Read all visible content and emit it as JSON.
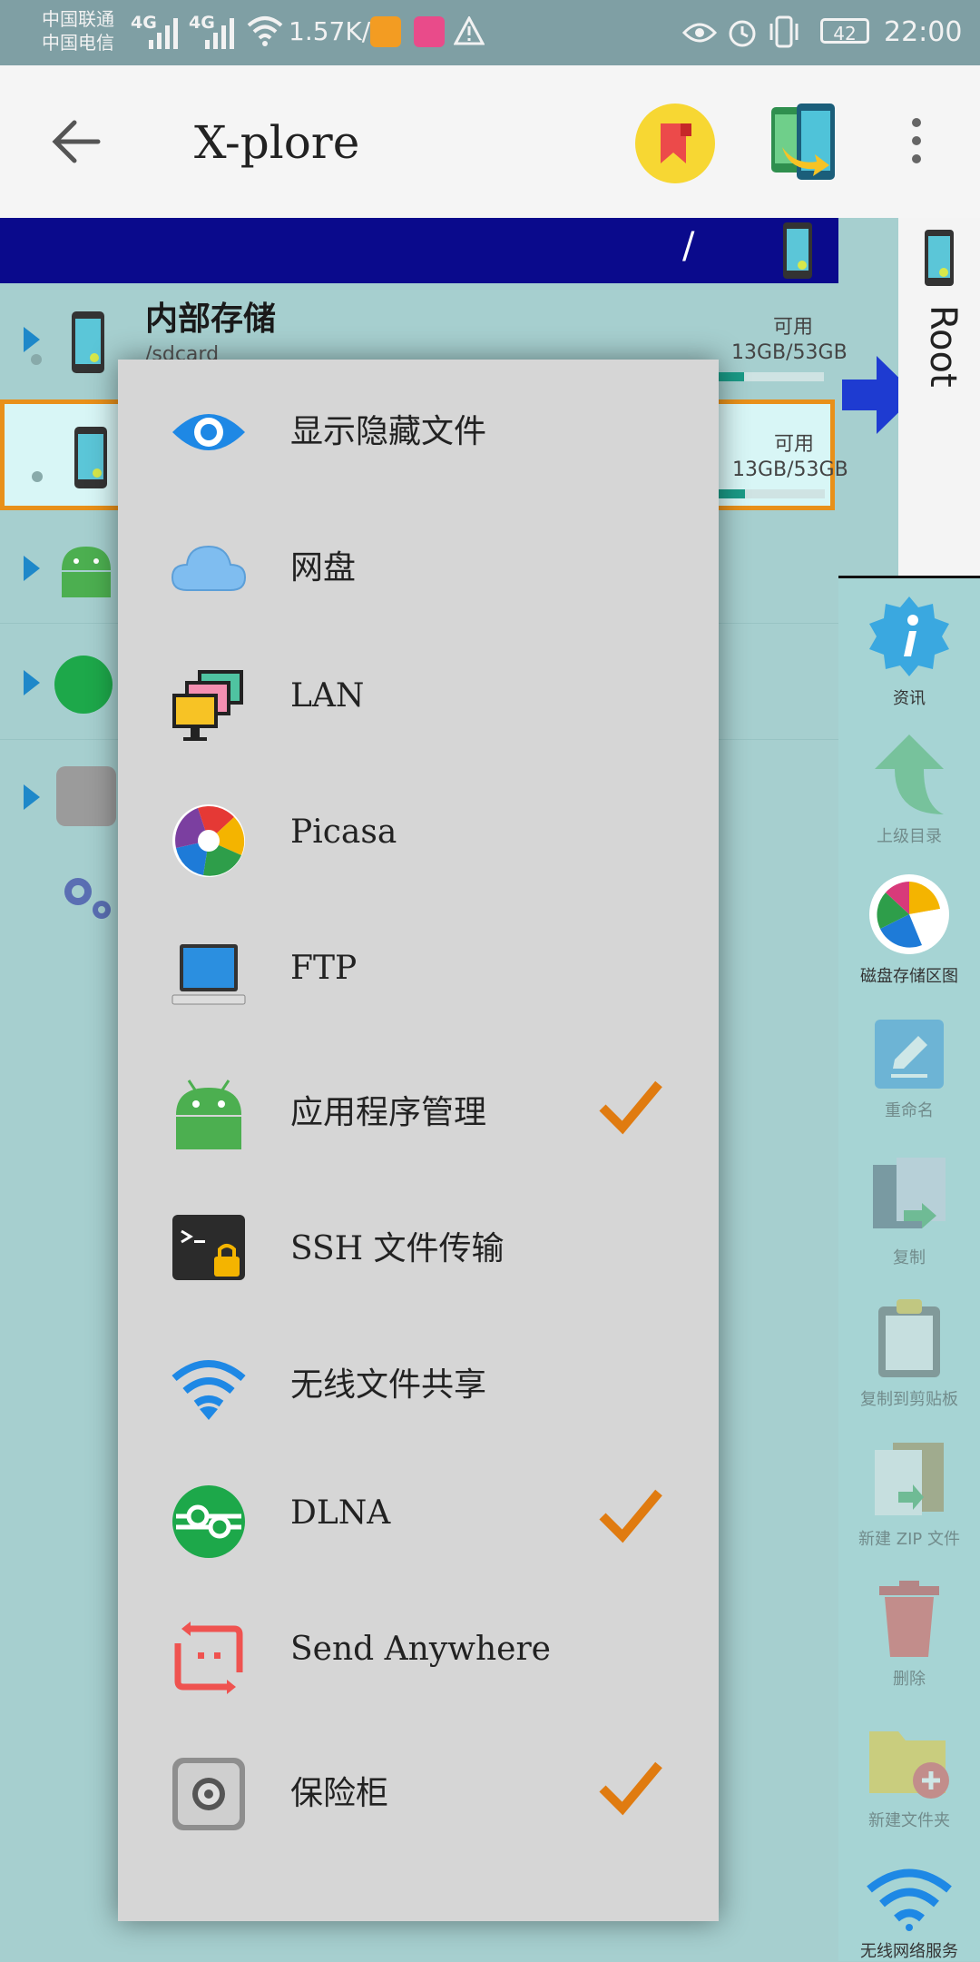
{
  "status_bar": {
    "carrier1": "中国联通",
    "carrier2": "中国电信",
    "net1": "4G",
    "net2": "4G",
    "speed": "1.57K/s",
    "battery": "42",
    "time": "22:00"
  },
  "app_bar": {
    "title": "X-plore"
  },
  "path_bar": {
    "path": "/"
  },
  "left_pane": {
    "storage": {
      "title": "内部存储",
      "path": "/sdcard",
      "avail_label": "可用",
      "size": "13GB/53GB",
      "used_fraction": 0.25
    },
    "storage2": {
      "avail_label": "可用",
      "size": "13GB/53GB",
      "used_fraction": 0.25
    }
  },
  "right_pane": {
    "label": "Root"
  },
  "menu": {
    "items": [
      {
        "label": "显示隐藏文件",
        "icon": "eye-icon",
        "checked": false
      },
      {
        "label": "网盘",
        "icon": "cloud-icon",
        "checked": false
      },
      {
        "label": "LAN",
        "icon": "lan-monitors-icon",
        "checked": false
      },
      {
        "label": "Picasa",
        "icon": "picasa-icon",
        "checked": false
      },
      {
        "label": "FTP",
        "icon": "laptop-icon",
        "checked": false
      },
      {
        "label": "应用程序管理",
        "icon": "android-icon",
        "checked": true
      },
      {
        "label": "SSH 文件传输",
        "icon": "terminal-lock-icon",
        "checked": false
      },
      {
        "label": "无线文件共享",
        "icon": "wifi-icon",
        "checked": false
      },
      {
        "label": "DLNA",
        "icon": "dlna-icon",
        "checked": true
      },
      {
        "label": "Send Anywhere",
        "icon": "send-anywhere-icon",
        "checked": false
      },
      {
        "label": "保险柜",
        "icon": "vault-icon",
        "checked": true
      }
    ],
    "check_color": "#e07b10"
  },
  "toolbar": {
    "items": [
      {
        "label": "资讯",
        "icon": "info-icon"
      },
      {
        "label": "上级目录",
        "icon": "up-arrow-icon"
      },
      {
        "label": "磁盘存储区图",
        "icon": "disk-map-icon"
      },
      {
        "label": "重命名",
        "icon": "rename-icon"
      },
      {
        "label": "复制",
        "icon": "copy-icon"
      },
      {
        "label": "复制到剪贴板",
        "icon": "clipboard-icon"
      },
      {
        "label": "新建 ZIP 文件",
        "icon": "zip-icon"
      },
      {
        "label": "删除",
        "icon": "trash-icon"
      },
      {
        "label": "新建文件夹",
        "icon": "new-folder-icon"
      },
      {
        "label": "无线网络服务",
        "icon": "wifi-service-icon"
      }
    ]
  }
}
